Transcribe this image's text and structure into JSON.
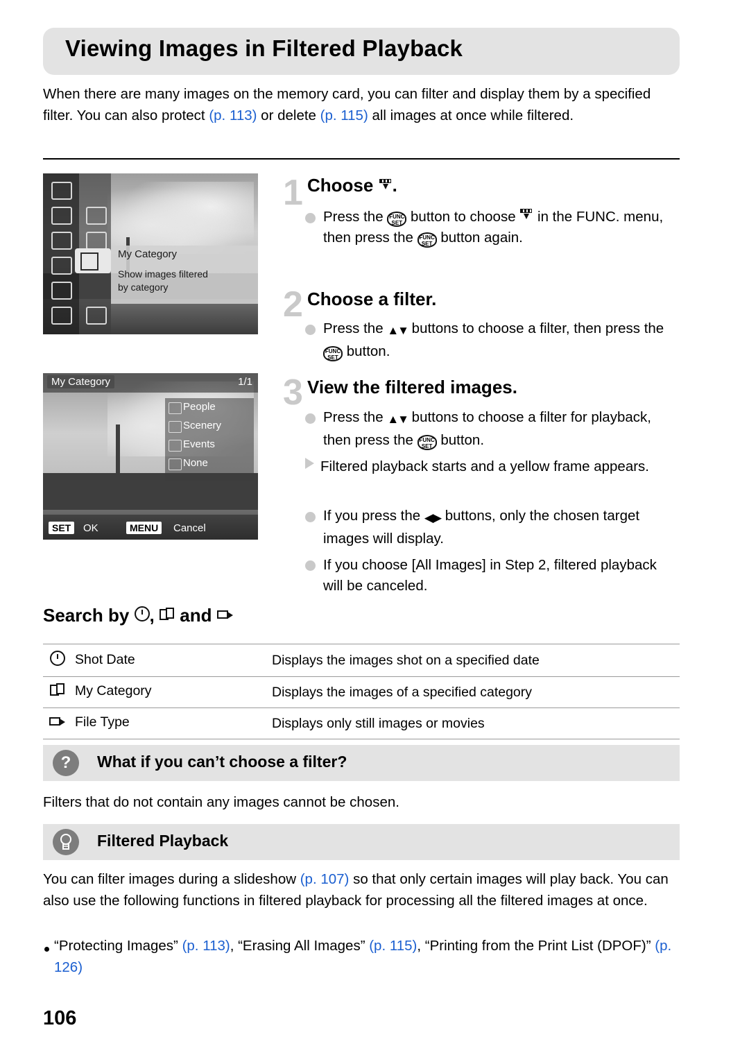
{
  "page": {
    "number": "106",
    "title": "Viewing Images in Filtered Playback"
  },
  "intro": {
    "part1": "When there are many images on the memory card, you can filter and display them by a specified filter. You can also protect ",
    "ref1": "(p. 113)",
    "part2": " or delete ",
    "ref2": "(p. 115)",
    "part3": " all images at once while filtered."
  },
  "screens": {
    "shot1": {
      "menu_title": "My Category",
      "menu_desc_line1": "Show images filtered",
      "menu_desc_line2": "by category"
    },
    "shot2": {
      "label": "My Category",
      "count": "1/1",
      "items": [
        "People",
        "Scenery",
        "Events",
        "None"
      ],
      "set_key": "SET",
      "set_label": "OK",
      "menu_key": "MENU",
      "menu_label": "Cancel"
    }
  },
  "steps": [
    {
      "number": "1",
      "heading": "Choose",
      "heading_suffix": ".",
      "lines": [
        "Press the",
        "button to choose",
        "in the FUNC. menu, then press the",
        "button again."
      ]
    },
    {
      "number": "2",
      "heading": "Choose a filter.",
      "lines": [
        "Press the",
        "buttons to choose a filter, then press the",
        "button."
      ]
    },
    {
      "number": "3",
      "heading": "View the filtered images.",
      "b1_a": "Press the",
      "b1_b": "buttons to choose a filter for playback, then press the",
      "b1_c": "button.",
      "b2": "Filtered playback starts and a yellow frame appears.",
      "b3_a": "If you press the",
      "b3_b": "buttons, only the chosen target images will display.",
      "b4": "If you choose [All Images] in Step 2, filtered playback will be canceled."
    }
  ],
  "search_section": {
    "heading_a": "Search by",
    "heading_b": ",",
    "heading_c": "and",
    "rows": [
      {
        "icon": "calendar-icon",
        "label": "Shot Date",
        "desc": "Displays the images shot on a specified date"
      },
      {
        "icon": "my-category-icon",
        "label": "My Category",
        "desc": "Displays the images of a specified category"
      },
      {
        "icon": "file-type-icon",
        "label": "File Type",
        "desc": "Displays only still images or movies"
      }
    ]
  },
  "callouts": [
    {
      "icon": "question-icon",
      "icon_glyph": "?",
      "heading": "What if you can’t choose a filter?",
      "body": "Filters that do not contain any images cannot be chosen."
    },
    {
      "icon": "lightbulb-icon",
      "icon_glyph": " ",
      "heading": "Filtered Playback",
      "body_a": "You can filter images during a slideshow ",
      "body_ref": "(p. 107)",
      "body_b": " so that only certain images will play back. You can also use the following functions in filtered playback for processing all the filtered images at once.",
      "bullet_a": "“Protecting Images” ",
      "bullet_ref1": "(p. 113)",
      "bullet_b": ", “Erasing All Images” ",
      "bullet_ref2": "(p. 115)",
      "bullet_c": ", “Printing from the Print List (DPOF)” ",
      "bullet_ref3": "(p. 126)"
    }
  ],
  "colors": {
    "link": "#1b5fd0",
    "panel": "#e3e3e3",
    "step_number": "#c9c9c9"
  }
}
